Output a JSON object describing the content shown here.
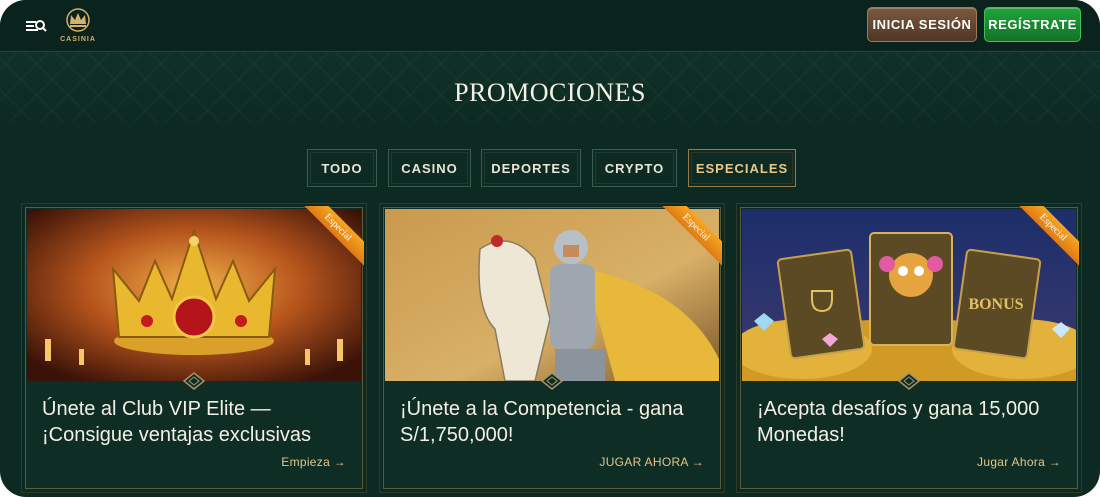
{
  "header": {
    "logo_text": "CASINIA",
    "login_label": "INICIA SESIÓN",
    "register_label": "REGÍSTRATE"
  },
  "page": {
    "title": "PROMOCIONES"
  },
  "tabs": [
    {
      "label": "TODO",
      "active": false
    },
    {
      "label": "CASINO",
      "active": false
    },
    {
      "label": "DEPORTES",
      "active": false
    },
    {
      "label": "CRYPTO",
      "active": false
    },
    {
      "label": "ESPECIALES",
      "active": true
    }
  ],
  "cards": [
    {
      "badge": "Especial",
      "title": "Únete al Club VIP Elite — ¡Consigue ventajas exclusivas",
      "cta": "Empieza →"
    },
    {
      "badge": "Especial",
      "title": "¡Únete a la Competencia - gana S/1,750,000!",
      "cta": "JUGAR AHORA →"
    },
    {
      "badge": "Especial",
      "title": "¡Acepta desafíos y gana 15,000 Monedas!",
      "cta": "Jugar Ahora →",
      "art_label": "BONUS"
    }
  ],
  "colors": {
    "accent_gold": "#e4c48c",
    "register_green": "#1c9a36",
    "background": "#0c2a22"
  },
  "icons": [
    "menu-search-icon",
    "crown-logo-icon",
    "diamond-divider-icon"
  ]
}
